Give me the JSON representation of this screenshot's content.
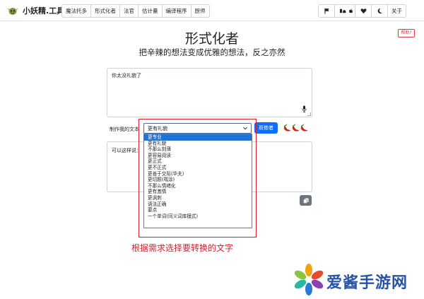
{
  "brand": {
    "name": "小妖精.工具"
  },
  "nav": {
    "items": [
      {
        "label": "魔法托多"
      },
      {
        "label": "形式化者"
      },
      {
        "label": "法官"
      },
      {
        "label": "估计量"
      },
      {
        "label": "编译程序"
      },
      {
        "label": "厨师"
      }
    ]
  },
  "toolbar": {
    "icons": [
      "flag-icon",
      "device-icons",
      "apple-icon",
      "heart-icon",
      "moon-icon"
    ],
    "about_label": "关于"
  },
  "help": {
    "label": "帮助?"
  },
  "heading": {
    "title": "形式化者",
    "subtitle": "把辛辣的想法变成优雅的想法，反之亦然"
  },
  "input": {
    "value": "你太没礼貌了"
  },
  "controls": {
    "make_label": "制作我的文本",
    "selected_value": "更有礼貌",
    "go_label": "斑侬者",
    "spice_level": 3
  },
  "dropdown": {
    "options": [
      {
        "label": "更专业",
        "selected": true
      },
      {
        "label": "更有礼貌"
      },
      {
        "label": "不那么刻薄"
      },
      {
        "label": "更容易阅读"
      },
      {
        "label": "更正式"
      },
      {
        "label": "更不正式"
      },
      {
        "label": "更善于交际(华夫)"
      },
      {
        "label": "更切题(喘涂)"
      },
      {
        "label": "不那么情绪化"
      },
      {
        "label": "更有激情"
      },
      {
        "label": "更讽刺"
      },
      {
        "label": "语法正确"
      },
      {
        "label": "要点"
      },
      {
        "label": "一个单词(同义词库模式)"
      }
    ]
  },
  "output": {
    "value": "可以这样说："
  },
  "annotation": {
    "text": "根据需求选择要转换的文字",
    "color": "#d81e2c"
  },
  "watermark": {
    "text": "爱酱手游网",
    "color": "#2554a7"
  },
  "colors": {
    "primary": "#0d6efd",
    "selected_option": "#1e73d6",
    "danger": "#dc3545"
  }
}
